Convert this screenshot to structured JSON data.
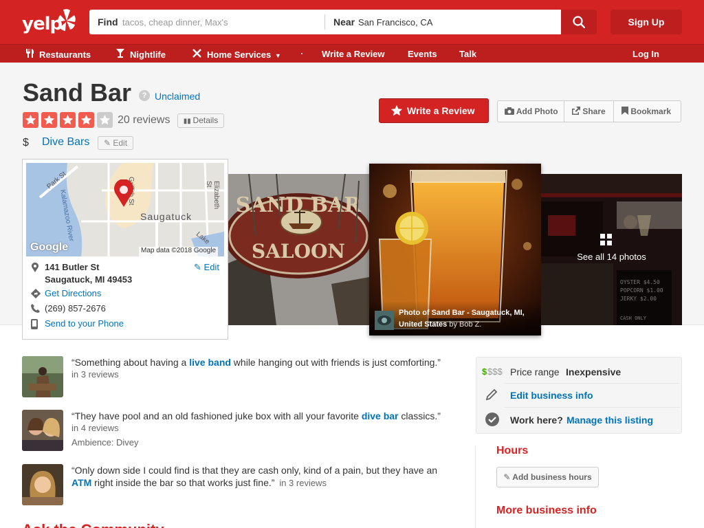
{
  "header": {
    "logo": "yelp",
    "find_label": "Find",
    "find_placeholder": "tacos, cheap dinner, Max's",
    "near_label": "Near",
    "near_value": "San Francisco, CA",
    "signup": "Sign Up"
  },
  "nav": {
    "restaurants": "Restaurants",
    "nightlife": "Nightlife",
    "home_services": "Home Services",
    "write_review": "Write a Review",
    "events": "Events",
    "talk": "Talk",
    "login": "Log In"
  },
  "business": {
    "name": "Sand Bar",
    "claim_status": "Unclaimed",
    "rating": 4,
    "rating_max": 5,
    "review_count": "20 reviews",
    "details": "Details",
    "price": "$",
    "category": "Dive Bars",
    "edit": "Edit"
  },
  "actions": {
    "write_review": "Write a Review",
    "add_photo": "Add Photo",
    "share": "Share",
    "bookmark": "Bookmark"
  },
  "map": {
    "streets": [
      "Park St",
      "Griffith St",
      "Elizabeth St",
      "Lake",
      "Kalamazoo River"
    ],
    "town": "Saugatuck",
    "google": "Google",
    "attribution": "Map data ©2018 Google",
    "edit": "Edit"
  },
  "info": {
    "address_line1": "141 Butler St",
    "address_line2": "Saugatuck, MI 49453",
    "directions": "Get Directions",
    "phone": "(269) 857-2676",
    "send_phone": "Send to your Phone"
  },
  "photos": {
    "caption_title": "Photo of Sand Bar - Saugatuck, MI, United States",
    "caption_by": "by Bob Z.",
    "see_all": "See all 14 photos"
  },
  "highlights": [
    {
      "pre": "“Something about having a ",
      "link": "live band",
      "post": " while hanging out with friends is just comforting.”",
      "count": "in 3 reviews"
    },
    {
      "pre": "“They have pool and an old fashioned juke box with all your favorite ",
      "link": "dive bar",
      "post": " classics.”",
      "count": "in 4 reviews",
      "extra": "Ambience: Divey"
    },
    {
      "pre": "“Only down side I could find is that they are cash only, kind of a pain, but they have an ",
      "link": "ATM",
      "post": " right inside the bar so that works just fine.”",
      "count": "in 3 reviews"
    }
  ],
  "sidebar": {
    "price_symbol_active": "$",
    "price_symbol_inactive": "$$$",
    "price_label": "Price range",
    "price_value": "Inexpensive",
    "edit_info": "Edit business info",
    "work_here": "Work here?",
    "manage": "Manage this listing",
    "hours_heading": "Hours",
    "add_hours": "Add business hours",
    "more_info": "More business info"
  },
  "community_heading": "Ask the Community",
  "colors": {
    "brand_red": "#d32323",
    "dark_red": "#bd1f1f",
    "link_blue": "#0073bb",
    "star_red": "#f15c4f",
    "price_green": "#41a700"
  }
}
